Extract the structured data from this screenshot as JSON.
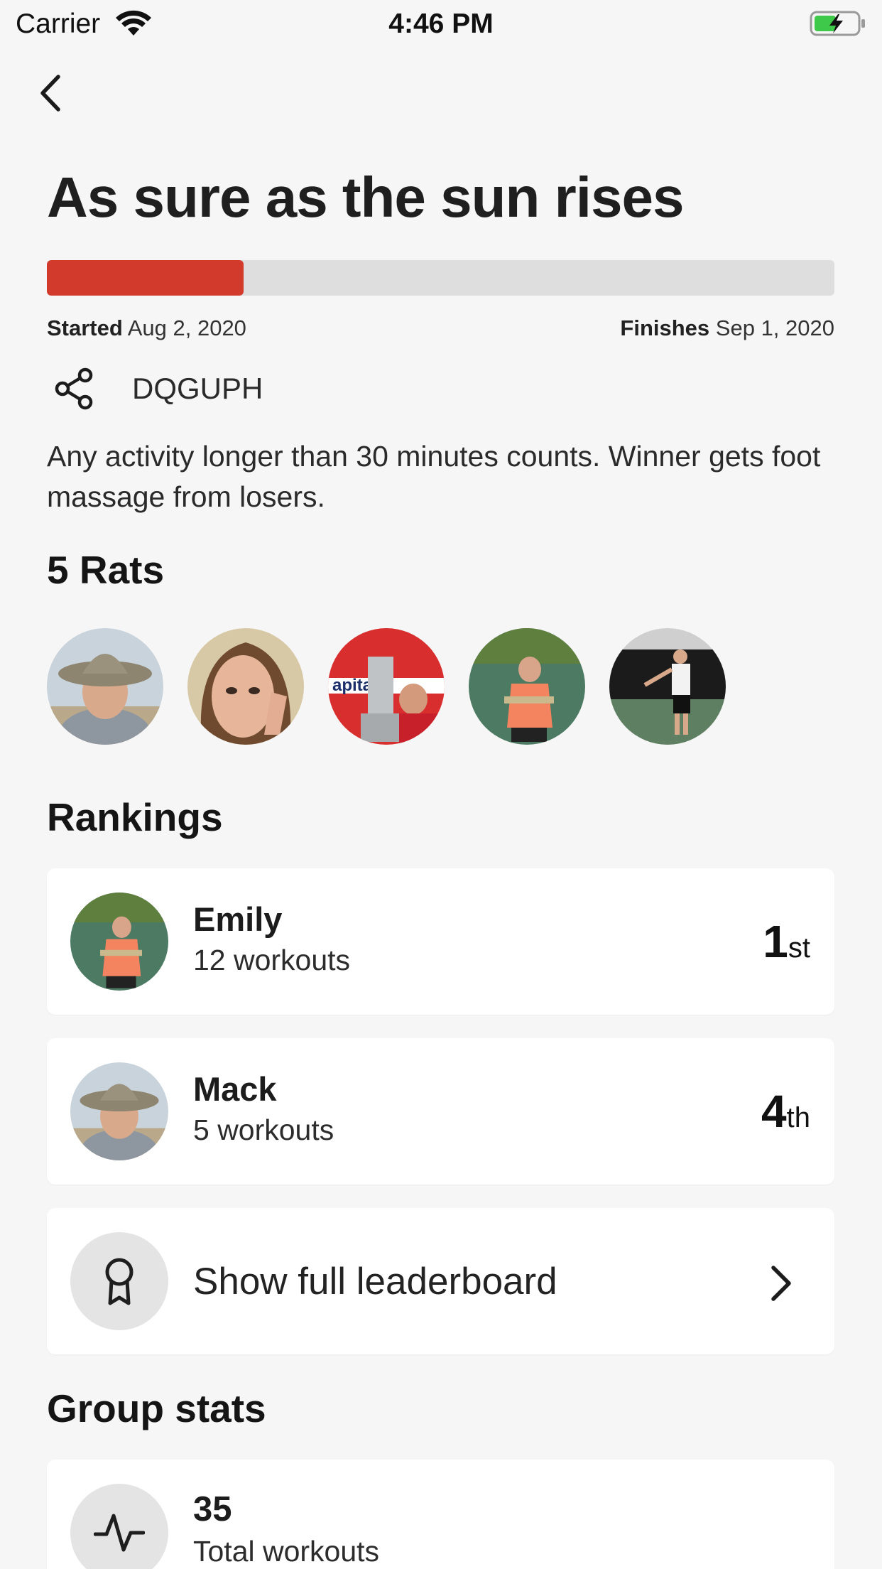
{
  "status_bar": {
    "carrier": "Carrier",
    "time": "4:46 PM",
    "wifi_icon": "wifi-icon",
    "battery_icon": "battery-charging-icon"
  },
  "nav": {
    "back_icon": "chevron-left-icon"
  },
  "challenge": {
    "title": "As sure as the sun rises",
    "progress_fraction": 0.25,
    "progress_color": "#d23a2c",
    "started_label": "Started",
    "started_date": "Aug 2, 2020",
    "finishes_label": "Finishes",
    "finishes_date": "Sep 1, 2020",
    "share_icon": "share-icon",
    "invite_code": "DQGUPH",
    "description": "Any activity longer than 30 minutes counts. Winner gets foot massage from losers."
  },
  "participants": {
    "title": "5 Rats",
    "avatars": [
      "avatar-1",
      "avatar-2",
      "avatar-3",
      "avatar-4",
      "avatar-5"
    ]
  },
  "rankings": {
    "title": "Rankings",
    "rows": [
      {
        "name": "Emily",
        "workouts": "12 workouts",
        "rank_number": "1",
        "rank_suffix": "st"
      },
      {
        "name": "Mack",
        "workouts": "5 workouts",
        "rank_number": "4",
        "rank_suffix": "th"
      }
    ],
    "leaderboard_label": "Show full leaderboard",
    "leaderboard_icon": "award-ribbon-icon",
    "chevron_icon": "chevron-right-icon"
  },
  "group_stats": {
    "title": "Group stats",
    "items": [
      {
        "value": "35",
        "label": "Total workouts",
        "icon": "activity-pulse-icon"
      }
    ]
  }
}
